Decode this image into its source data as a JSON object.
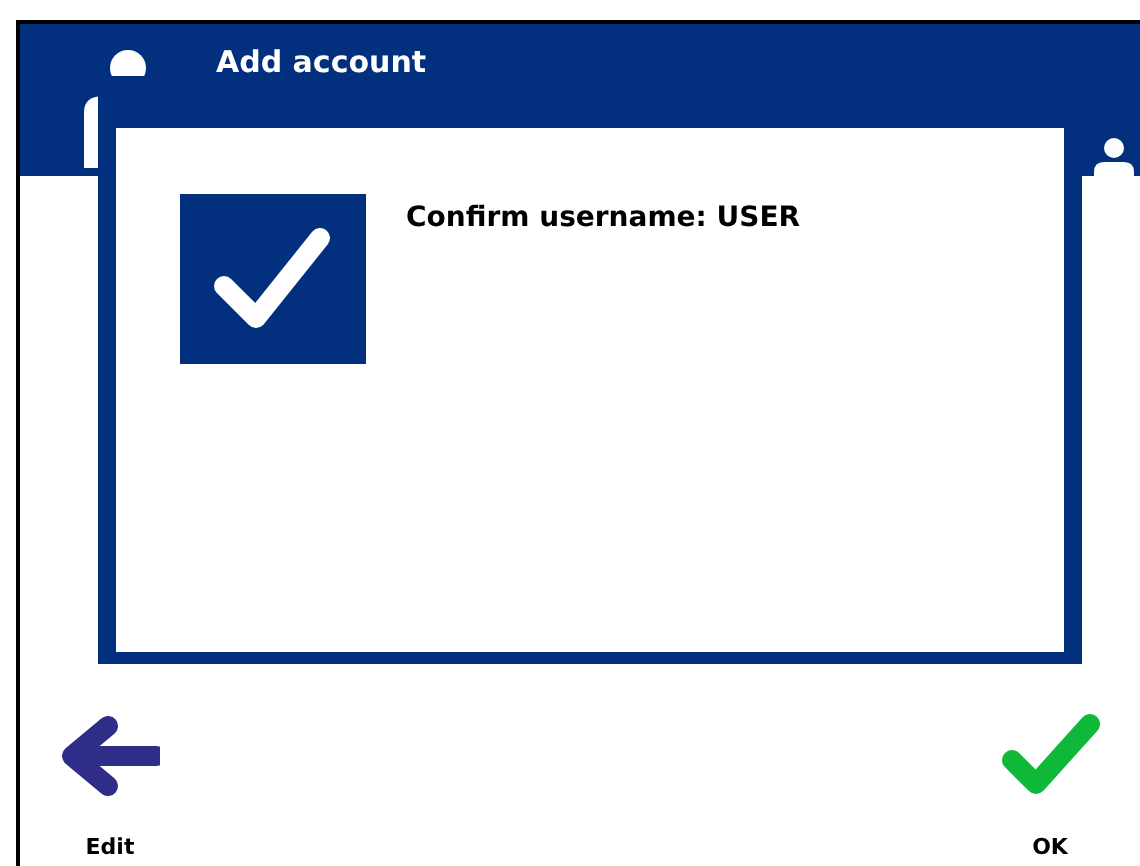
{
  "header": {
    "title": "Add account"
  },
  "dialog": {
    "message": "Confirm username: USER"
  },
  "footer": {
    "buttons": [
      {
        "kind": "back",
        "label": "Edit"
      },
      {
        "kind": "confirm",
        "label": "OK"
      }
    ]
  }
}
